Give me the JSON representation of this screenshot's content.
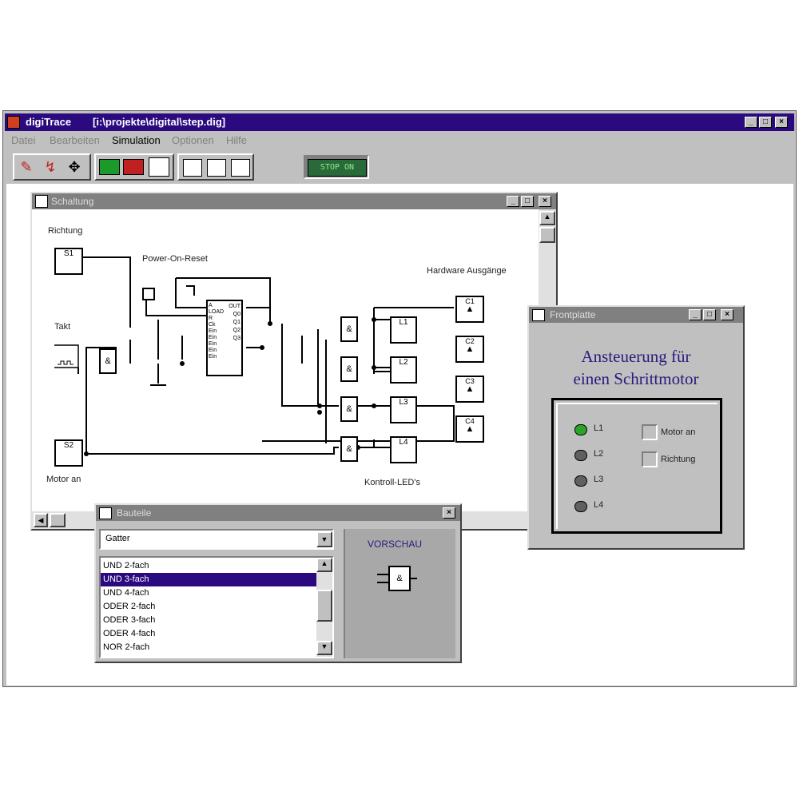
{
  "app": {
    "name": "digiTrace",
    "path": "[i:\\projekte\\digital\\step.dig]"
  },
  "menu": [
    "Datei",
    "Bearbeiten",
    "Simulation",
    "Optionen",
    "Hilfe"
  ],
  "menu_active": "Simulation",
  "toolbar": {
    "status_display": "STOP  ON"
  },
  "schaltung": {
    "title": "Schaltung",
    "labels": {
      "richtung": "Richtung",
      "power_on_reset": "Power-On-Reset",
      "hardware_ausgaenge": "Hardware Ausgänge",
      "takt": "Takt",
      "motor_an": "Motor an",
      "kontroll_leds": "Kontroll-LED's"
    },
    "switches": [
      "S1",
      "S2"
    ],
    "leds": [
      "L1",
      "L2",
      "L3",
      "L4"
    ],
    "outputs": [
      "C1",
      "C2",
      "C3",
      "C4"
    ],
    "gate_and": "&",
    "chip_pins_left": [
      "A",
      "LOAD",
      "R",
      "Ck",
      "Ein",
      "Ein",
      "Ein",
      "Ein",
      "Ein"
    ],
    "chip_pins_right": [
      "OUT",
      "Q0",
      "Q1",
      "Q2",
      "Q3"
    ]
  },
  "frontplatte": {
    "title": "Frontplatte",
    "heading_line1": "Ansteuerung für",
    "heading_line2": "einen Schrittmotor",
    "lamps": [
      "L1",
      "L2",
      "L3",
      "L4"
    ],
    "checkboxes": [
      "Motor an",
      "Richtung"
    ],
    "heading_color": "#2a1a7e",
    "lamp_on_color": "#2aa52a"
  },
  "bauteile": {
    "title": "Bauteile",
    "category": "Gatter",
    "items": [
      "UND 2-fach",
      "UND 3-fach",
      "UND 4-fach",
      "ODER 2-fach",
      "ODER 3-fach",
      "ODER 4-fach",
      "NOR 2-fach"
    ],
    "selected": "UND 3-fach",
    "preview_label": "VORSCHAU",
    "preview_symbol": "&"
  }
}
